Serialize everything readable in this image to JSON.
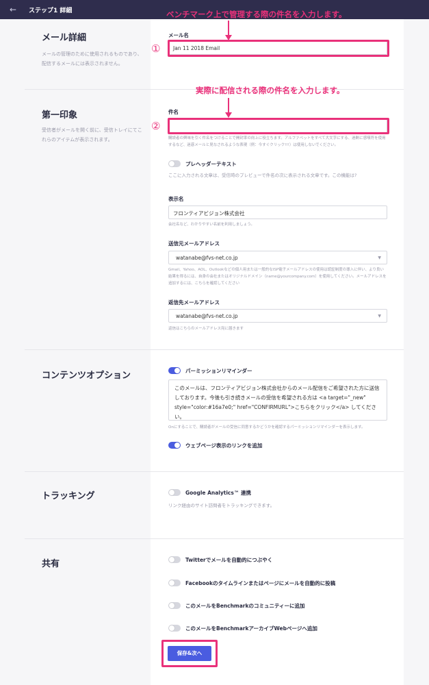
{
  "header": {
    "back_icon": "←",
    "step_label": "ステップ1 詳細",
    "chevron": "⌄"
  },
  "annotations": {
    "top_callout": "ベンチマーク上で管理する際の件名を入力します。",
    "mid_callout": "実際に配信される際の件名を入力します。",
    "num1": "①",
    "num2": "②"
  },
  "sections": {
    "mail_details": {
      "title": "メール詳細",
      "desc": "メールの管理のために使用されるものであり、配信するメールには表示されません。",
      "field_label": "メール名",
      "field_value": "Jan 11 2018 Email"
    },
    "first_impression": {
      "title": "第一印象",
      "desc": "受信者がメールを開く前に、受信トレイにてこれらのアイテムが表示されます。",
      "subject_label": "件名",
      "subject_value": "",
      "subject_help": "購読者の興味を引く件名をつけることで開封率の向上に役立ちます。アルファベットをすべて大文字にする、過剰に感嘆符を使用するなど、迷惑メールと見なされるような表現（例：今すぐクリック!!!）は使用しないでください。",
      "preheader_label": "プレヘッダーテキスト",
      "preheader_help": "ここに入力される文章は、受信時のプレビューで件名の次に表示される文章です。この機能は?",
      "from_name_label": "表示名",
      "from_name_value": "フロンティアビジョン株式会社",
      "from_name_help": "会社名など、わかりやすい名前を利用しましょう。",
      "from_email_label": "送信元メールアドレス",
      "from_email_value": "watanabe@fvs-net.co.jp",
      "from_email_help": "Gmail、Yahoo、AOL、Outlookなどの個人用または一般的なISP電子メールアドレスの使用は認証制度の導入に伴い、より良い結果を得るには、自身の会社またはオリジナルドメイン（name@yourcompany.com）を使用してください。メールアドレスを追加するには、こちらを確認してください",
      "reply_email_label": "返信先メールアドレス",
      "reply_email_value": "watanabe@fvs-net.co.jp",
      "reply_email_help": "返信はこちらのメールアドレス宛に届きます"
    },
    "content_options": {
      "title": "コンテンツオプション",
      "permission_label": "パーミッションリマインダー",
      "permission_text": "このメールは、フロンティアビジョン株式会社からのメール配信をご希望された方に送信しております。今後も引き続きメールの受信を希望される方は <a target=\"_new\" style=\"color:#16a7e0;\" href=\"CONFIRMURL\">こちらをクリック</a> してください。",
      "permission_help": "Onにすることで、購読者がメールの受信に同意するかどうかを確認するパーミッションリマインダーを表示します。",
      "webpage_label": "ウェブページ表示のリンクを追加"
    },
    "tracking": {
      "title": "トラッキング",
      "ga_label": "Google Analytics™ 連携",
      "ga_help": "リンク経由のサイト訪問者をトラッキングできます。"
    },
    "share": {
      "title": "共有",
      "twitter_label": "Twitterでメールを自動的につぶやく",
      "facebook_label": "Facebookのタイムラインまたはページにメールを自動的に投稿",
      "community_label": "このメールをBenchmarkのコミュニティーに追加",
      "archive_label": "このメールをBenchmarkアーカイブWebページへ追加"
    }
  },
  "save_button": "保存&次へ",
  "colors": {
    "accent": "#4a5ce0",
    "annotation": "#e9317a",
    "header": "#2f2d4d"
  }
}
